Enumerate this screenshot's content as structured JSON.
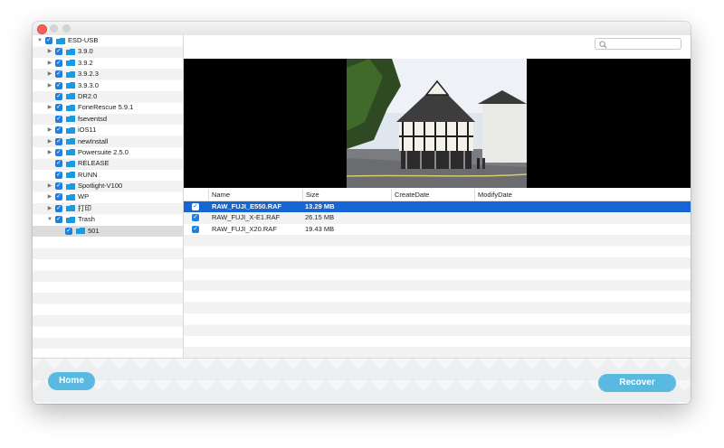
{
  "sidebar": {
    "items": [
      {
        "label": "ESD-USB",
        "depth": 0,
        "expanded": true,
        "has_children": true,
        "checked": true
      },
      {
        "label": "3.9.0",
        "depth": 1,
        "expanded": false,
        "has_children": true,
        "checked": true
      },
      {
        "label": "3.9.2",
        "depth": 1,
        "expanded": false,
        "has_children": true,
        "checked": true
      },
      {
        "label": "3.9.2.3",
        "depth": 1,
        "expanded": false,
        "has_children": true,
        "checked": true
      },
      {
        "label": "3.9.3.0",
        "depth": 1,
        "expanded": false,
        "has_children": true,
        "checked": true
      },
      {
        "label": "DR2.0",
        "depth": 1,
        "expanded": false,
        "has_children": false,
        "checked": true
      },
      {
        "label": "FoneRescue 5.9.1",
        "depth": 1,
        "expanded": false,
        "has_children": true,
        "checked": true
      },
      {
        "label": "fseventsd",
        "depth": 1,
        "expanded": false,
        "has_children": false,
        "checked": true
      },
      {
        "label": "iOS11",
        "depth": 1,
        "expanded": false,
        "has_children": true,
        "checked": true
      },
      {
        "label": "newInstall",
        "depth": 1,
        "expanded": false,
        "has_children": true,
        "checked": true
      },
      {
        "label": "Powersuite 2.5.0",
        "depth": 1,
        "expanded": false,
        "has_children": true,
        "checked": true
      },
      {
        "label": "RELEASE",
        "depth": 1,
        "expanded": false,
        "has_children": false,
        "checked": true
      },
      {
        "label": "RUNN",
        "depth": 1,
        "expanded": false,
        "has_children": false,
        "checked": true
      },
      {
        "label": "Spotlight-V100",
        "depth": 1,
        "expanded": false,
        "has_children": true,
        "checked": true
      },
      {
        "label": "WP",
        "depth": 1,
        "expanded": false,
        "has_children": true,
        "checked": true
      },
      {
        "label": "打印",
        "depth": 1,
        "expanded": false,
        "has_children": true,
        "checked": true
      },
      {
        "label": "Trash",
        "depth": 1,
        "expanded": true,
        "has_children": true,
        "checked": true
      },
      {
        "label": "501",
        "depth": 2,
        "expanded": false,
        "has_children": false,
        "checked": true,
        "selected": true
      }
    ]
  },
  "search": {
    "placeholder": ""
  },
  "table": {
    "columns": [
      "Name",
      "Size",
      "CreateDate",
      "ModifyDate"
    ],
    "rows": [
      {
        "name": "RAW_FUJI_E550.RAF",
        "size": "13.29 MB",
        "create": "",
        "modify": "",
        "checked": true,
        "selected": true
      },
      {
        "name": "RAW_FUJI_X-E1.RAF",
        "size": "26.15 MB",
        "create": "",
        "modify": "",
        "checked": true,
        "selected": false
      },
      {
        "name": "RAW_FUJI_X20.RAF",
        "size": "19.43 MB",
        "create": "",
        "modify": "",
        "checked": true,
        "selected": false
      }
    ]
  },
  "buttons": {
    "home": "Home",
    "recover": "Recover"
  },
  "icons": {
    "folder": "folder-icon",
    "search": "search-icon",
    "checkbox": "checkmark-icon"
  },
  "colors": {
    "accent": "#1e7fe0",
    "selection": "#1565d4",
    "button": "#5ab9e0",
    "folder": "#1a9be0"
  }
}
